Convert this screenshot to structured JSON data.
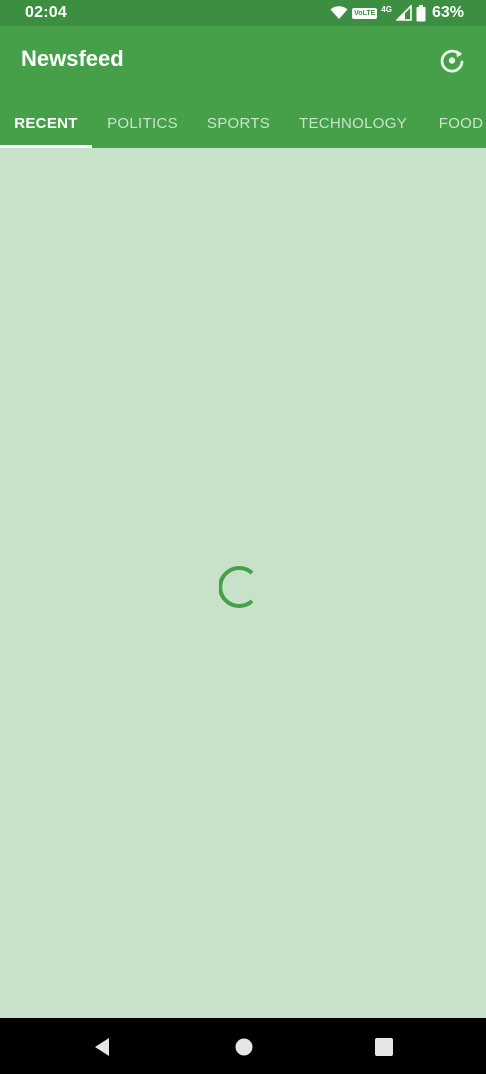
{
  "status_bar": {
    "time": "02:04",
    "volte": "VoLTE",
    "network_type": "4G",
    "battery_percent": "63%",
    "icons": [
      "wifi-icon",
      "volte-icon",
      "signal-icon",
      "battery-icon"
    ]
  },
  "app_bar": {
    "title": "Newsfeed",
    "refresh_icon": "refresh-icon"
  },
  "tabs": [
    {
      "label": "RECENT",
      "active": true
    },
    {
      "label": "POLITICS",
      "active": false
    },
    {
      "label": "SPORTS",
      "active": false
    },
    {
      "label": "TECHNOLOGY",
      "active": false
    },
    {
      "label": "FOOD",
      "active": false
    }
  ],
  "content": {
    "state": "loading",
    "spinner_icon": "loading-spinner-icon"
  },
  "nav_bar": {
    "buttons": [
      "back-icon",
      "home-icon",
      "recents-icon"
    ]
  },
  "colors": {
    "status_bar": "#3c8f41",
    "app_bar": "#45a049",
    "background": "#c8e2c9",
    "spinner": "#45a049",
    "nav_bar": "#000000"
  }
}
